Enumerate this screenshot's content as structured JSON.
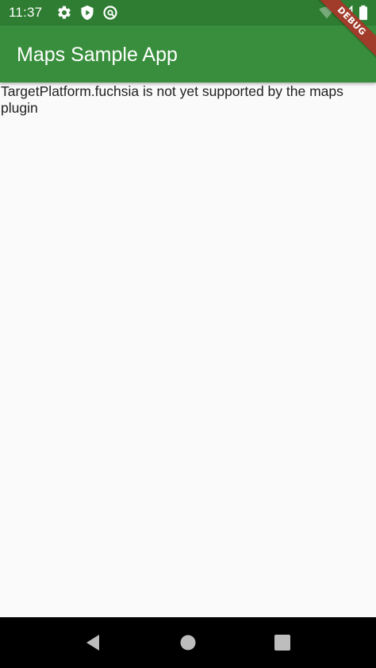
{
  "status_bar": {
    "time": "11:37",
    "left_icons": [
      "gear-icon",
      "shield-play-icon",
      "no-disturb-icon"
    ],
    "right_icons": [
      "wifi-icon",
      "signal-icon",
      "battery-icon"
    ]
  },
  "app_bar": {
    "title": "Maps Sample App"
  },
  "debug_banner": {
    "label": "DEBUG"
  },
  "content": {
    "message": "TargetPlatform.fuchsia is not yet supported by the maps plugin"
  },
  "nav_bar": {
    "buttons": [
      "back-icon",
      "home-icon",
      "recents-icon"
    ]
  },
  "colors": {
    "status_bar": "#2E7D32",
    "app_bar": "#388E3C",
    "background": "#FAFAFA",
    "banner": "#A13B2A",
    "nav_bar": "#000000"
  }
}
